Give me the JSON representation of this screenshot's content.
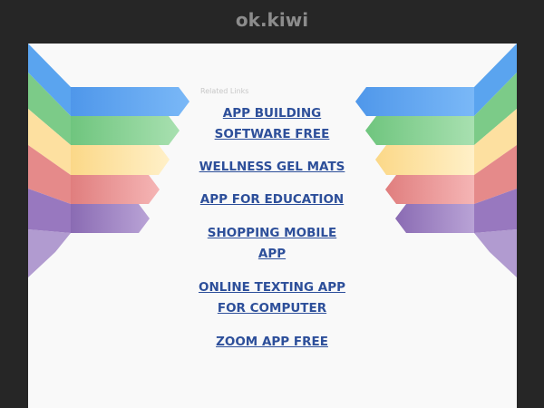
{
  "site": {
    "domain": "ok.kiwi"
  },
  "related": {
    "heading": "Related Links",
    "links": [
      [
        "APP BUILDING",
        "SOFTWARE FREE"
      ],
      [
        "WELLNESS GEL MATS"
      ],
      [
        "APP FOR EDUCATION"
      ],
      [
        "SHOPPING MOBILE",
        "APP"
      ],
      [
        "ONLINE TEXTING APP",
        "FOR COMPUTER"
      ],
      [
        "ZOOM APP FREE"
      ]
    ]
  },
  "colors": {
    "background": "#262626",
    "panel": "#f9f9f9",
    "link": "#2d4f9a",
    "wing_blue": "#5ba7f2",
    "wing_green": "#7dd18a",
    "wing_yellow": "#fde3a0",
    "wing_red": "#e88f8f",
    "wing_purple": "#9b7cc0"
  }
}
